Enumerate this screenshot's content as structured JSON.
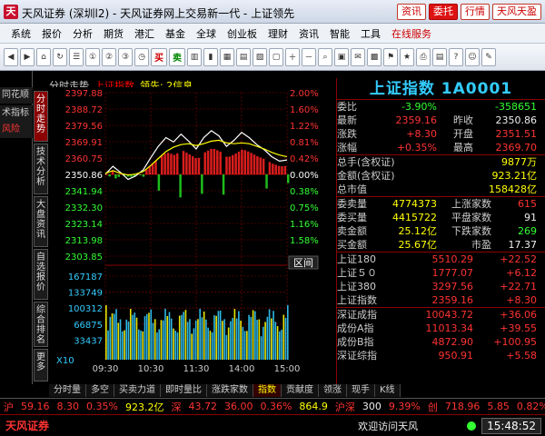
{
  "titlebar": {
    "title": "天风证券 (深圳l2) - 天风证券网上交易新一代 - 上证领先",
    "buttons": [
      "资讯",
      "委托",
      "行情",
      "天风天盈"
    ]
  },
  "menubar": {
    "items": [
      "系统",
      "报价",
      "分析",
      "期货",
      "港汇",
      "基金",
      "全球",
      "创业板",
      "理财",
      "资讯",
      "智能",
      "工具",
      "在线服务"
    ]
  },
  "toolbar": {
    "buy": "买",
    "sell": "卖"
  },
  "left_tabs": {
    "crumbs": [
      "同花顺",
      "术指标",
      "风险"
    ],
    "vtabs": [
      "分时走势",
      "技术分析",
      "大盘资讯",
      "自选报价",
      "综合排名",
      "更多"
    ]
  },
  "chart_header": {
    "mode": "分时走势",
    "index": "上证指数",
    "lead": "领先: 2信息"
  },
  "chart_data": {
    "type": "line",
    "title": "",
    "x_labels": [
      "09:30",
      "10:30",
      "11:30",
      "14:00",
      "15:00"
    ],
    "price_axis": [
      "2397.88",
      "2388.72",
      "2379.56",
      "2369.91",
      "2360.75",
      "2350.86",
      "2341.94",
      "2332.30",
      "2323.14",
      "2313.98",
      "2303.85"
    ],
    "pct_axis": [
      "2.00%",
      "1.60%",
      "1.22%",
      "0.81%",
      "0.42%",
      "0.00%",
      "0.38%",
      "0.75%",
      "1.16%",
      "1.58%"
    ],
    "volume_axis": [
      "167187",
      "133749",
      "100312",
      "66875",
      "33437"
    ],
    "volume_unit": "X10",
    "period_label": "区间",
    "prev_close": 2350.86,
    "ylim": [
      2303.85,
      2397.88
    ],
    "series": [
      {
        "values": [
          2351.0,
          2355.5,
          2352.0,
          2348.0,
          2350.0,
          2353.5,
          2360.5,
          2367.0,
          2372.0,
          2369.5,
          2374.0,
          2370.0,
          2365.5,
          2372.0,
          2376.0,
          2373.0,
          2367.0,
          2370.5,
          2375.0,
          2372.0,
          2368.0,
          2365.0,
          2361.0,
          2358.5,
          2359.16
        ],
        "color": "#ffffff"
      },
      {
        "values": [
          2351.5,
          2353.0,
          2351.5,
          2350.5,
          2351.0,
          2352.5,
          2356.0,
          2360.0,
          2364.0,
          2366.5,
          2368.0,
          2368.5,
          2367.5,
          2368.5,
          2370.0,
          2370.5,
          2369.0,
          2368.5,
          2369.0,
          2368.5,
          2367.0,
          2365.5,
          2363.5,
          2362.0,
          2361.0
        ],
        "color": "#ffff00"
      }
    ]
  },
  "rpanel": {
    "title": "上证指数 1A0001",
    "rows1": [
      {
        "a": "委比",
        "b": "-3.90%",
        "c": "-358651"
      },
      {
        "a": "最新",
        "b": "2359.16",
        "c": "昨收",
        "d": "2350.86"
      },
      {
        "a": "涨跌",
        "b": "+8.30",
        "c": "开盘",
        "d": "2351.51"
      },
      {
        "a": "涨幅",
        "b": "+0.35%",
        "c": "最高",
        "d": "2369.70"
      }
    ],
    "rows2": [
      {
        "a": "总手(含权证)",
        "b": "9877万"
      },
      {
        "a": "金额(含权证)",
        "b": "923.21亿"
      },
      {
        "a": "总市值",
        "b": "158428亿"
      }
    ],
    "rows3": [
      {
        "a": "委卖量",
        "b": "4774373",
        "c": "上涨家数",
        "d": "615"
      },
      {
        "a": "委买量",
        "b": "4415722",
        "c": "平盘家数",
        "d": "91"
      },
      {
        "a": "卖金额",
        "b": "25.12亿",
        "c": "下跌家数",
        "d": "269"
      },
      {
        "a": "买金额",
        "b": "25.67亿",
        "c": "市盈",
        "d": "17.37"
      }
    ],
    "rows4": [
      {
        "a": "上证180",
        "b": "5510.29",
        "c": "+22.52"
      },
      {
        "a": "上证５０",
        "b": "1777.07",
        "c": "+6.12"
      },
      {
        "a": "上证380",
        "b": "3297.56",
        "c": "+22.71"
      },
      {
        "a": "上证指数",
        "b": "2359.16",
        "c": "+8.30"
      }
    ],
    "rows5": [
      {
        "a": "深证成指",
        "b": "10043.72",
        "c": "+36.06"
      },
      {
        "a": "成份A指",
        "b": "11013.34",
        "c": "+39.55"
      },
      {
        "a": "成份B指",
        "b": "4872.90",
        "c": "+100.95"
      },
      {
        "a": "深证综指",
        "b": "950.91",
        "c": "+5.58"
      }
    ]
  },
  "bottom_tabs": [
    "分时量",
    "多空",
    "买卖力道",
    "即时量比",
    "涨跌家数",
    "指数",
    "贡献度",
    "领涨",
    "现手",
    "K线"
  ],
  "ticker": {
    "a": "沪",
    "b": "59.16",
    "c": "8.30",
    "d": "0.35%",
    "e": "923.2亿",
    "f": "深",
    "g": "43.72",
    "h": "36.00",
    "i": "0.36%",
    "j": "864.9",
    "k": "沪深",
    "l": "300",
    "m": "9.39%",
    "n": "创",
    "o": "718.96",
    "p": "5.85",
    "q": "0.82%"
  },
  "status": {
    "brand": "天风证券",
    "welcome": "欢迎访问天风",
    "clock": "15:48:52"
  }
}
